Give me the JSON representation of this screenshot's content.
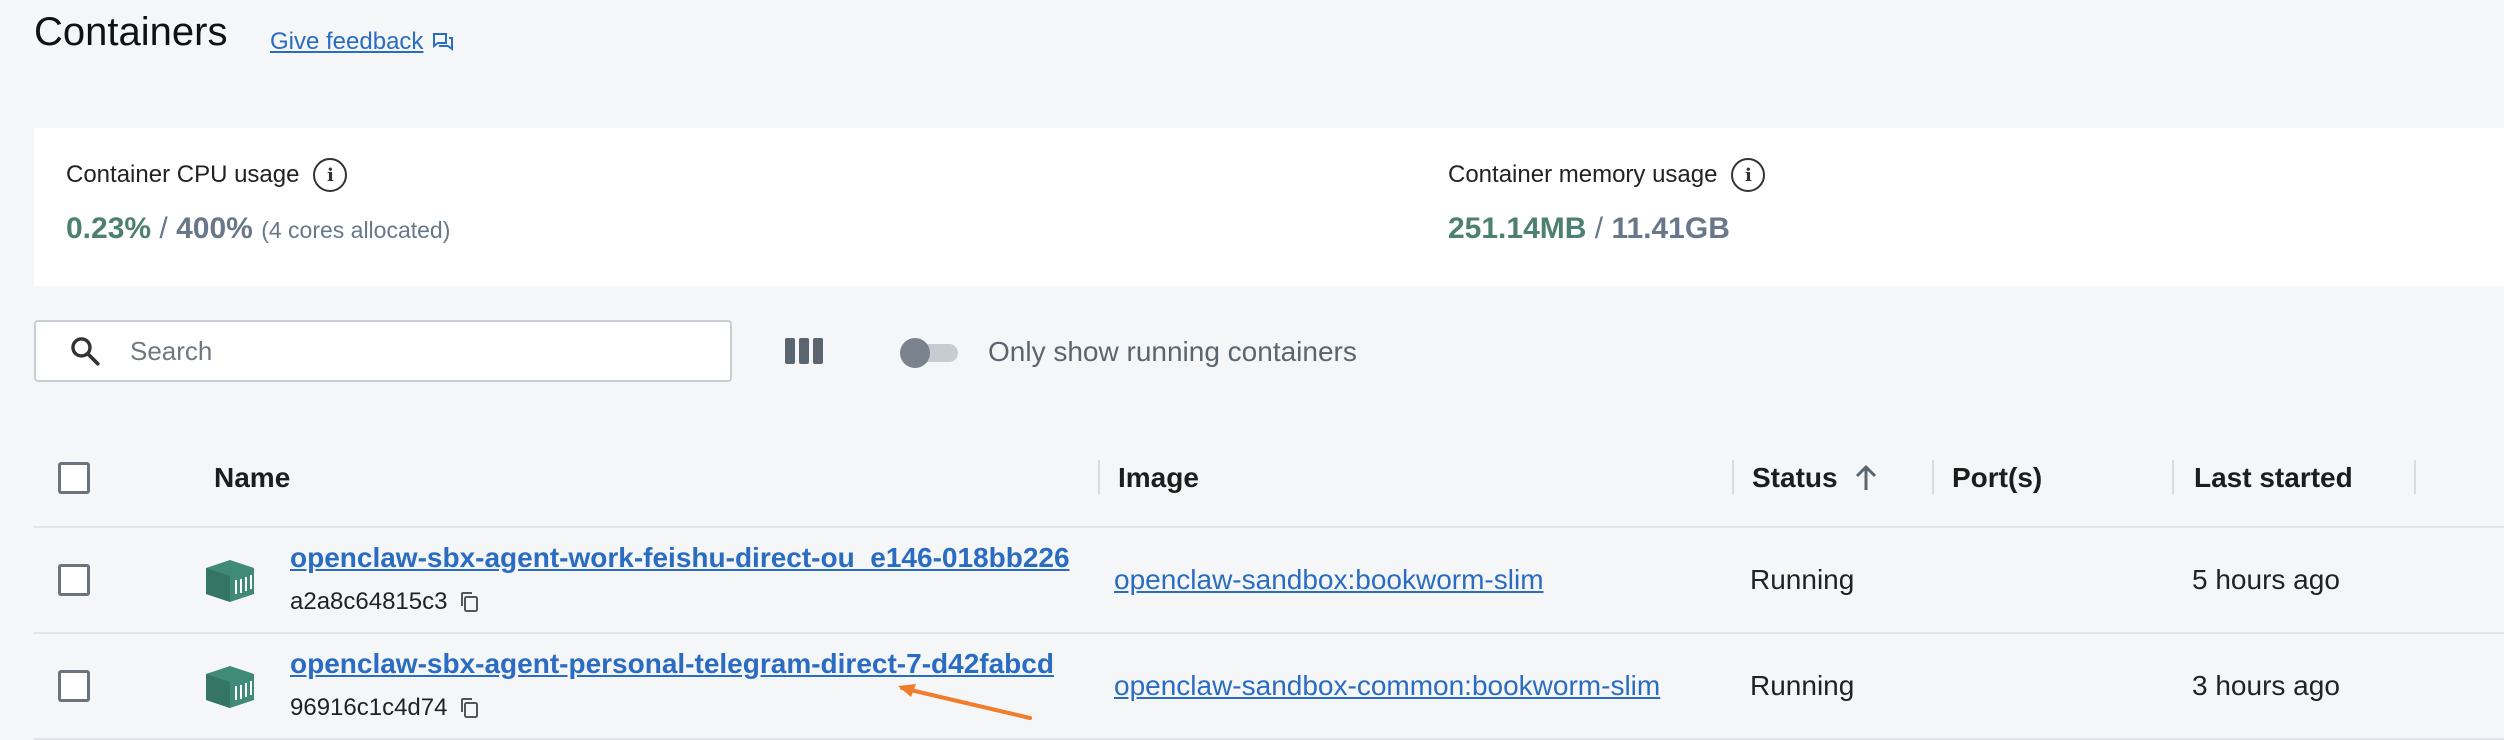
{
  "header": {
    "title": "Containers",
    "feedback_label": "Give feedback"
  },
  "usage": {
    "cpu": {
      "label": "Container CPU usage",
      "value": "0.23%",
      "separator": "/",
      "total": "400%",
      "note": "(4 cores allocated)"
    },
    "memory": {
      "label": "Container memory usage",
      "value": "251.14MB",
      "separator": "/",
      "total": "11.41GB"
    }
  },
  "toolbar": {
    "search_placeholder": "Search",
    "running_toggle_label": "Only show running containers",
    "running_toggle_on": false
  },
  "table": {
    "columns": {
      "name": "Name",
      "image": "Image",
      "status": "Status",
      "ports": "Port(s)",
      "last_started": "Last started"
    },
    "sort": {
      "column": "status",
      "direction": "ascending"
    },
    "rows": [
      {
        "name": "openclaw-sbx-agent-work-feishu-direct-ou_e146-018bb226",
        "id": "a2a8c64815c3",
        "image": "openclaw-sandbox:bookworm-slim",
        "status": "Running",
        "ports": "",
        "last_started": "5 hours ago"
      },
      {
        "name": "openclaw-sbx-agent-personal-telegram-direct-7-d42fabcd",
        "id": "96916c1c4d74",
        "image": "openclaw-sandbox-common:bookworm-slim",
        "status": "Running",
        "ports": "",
        "last_started": "3 hours ago"
      }
    ]
  },
  "colors": {
    "link": "#2a6cc2",
    "usage_value": "#4c8070",
    "container_icon": "#3f8a78",
    "annotation_arrow": "#f07c2c"
  }
}
